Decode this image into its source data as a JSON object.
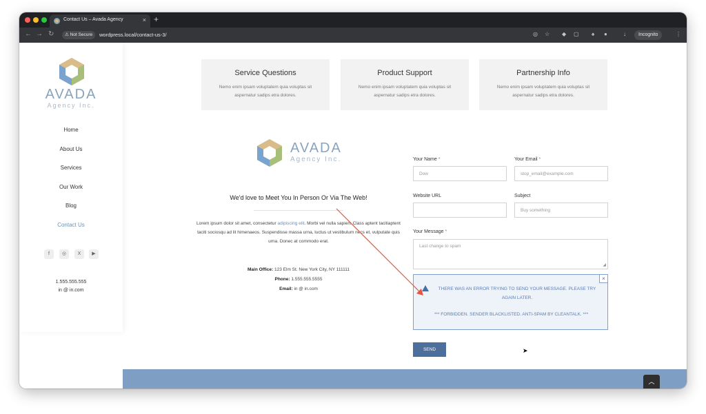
{
  "browser": {
    "tab_title": "Contact Us – Avada Agency",
    "tab_close": "×",
    "new_tab": "+",
    "not_secure": "⚠ Not Secure",
    "url": "wordpress.local/contact-us-3/",
    "incognito": "Incognito"
  },
  "sidebar": {
    "brand_name": "AVADA",
    "brand_sub": "Agency Inc.",
    "nav": [
      "Home",
      "About Us",
      "Services",
      "Our Work",
      "Blog",
      "Contact Us"
    ],
    "active_index": 5,
    "social": [
      "f",
      "◎",
      "X",
      "▶"
    ],
    "phone": "1.555.555.555",
    "email": "in @ in.com"
  },
  "cards": [
    {
      "title": "Service Questions",
      "text": "Nemo enim ipsam voluptatem quia voluptas sit aspernatur sadips etra dolores."
    },
    {
      "title": "Product Support",
      "text": "Nemo enim ipsam voluptatem quia voluptas sit aspernatur sadips etra dolores."
    },
    {
      "title": "Partnership Info",
      "text": "Nemo enim ipsam voluptatem quia voluptas sit aspernatur sadips etra dolores."
    }
  ],
  "content": {
    "brand_name": "AVADA",
    "brand_sub": "Agency Inc.",
    "tagline": "We'd love to Meet You In Person  Or Via The Web!",
    "lorem_a": "Lorem ipsum dolor sit amet, consectetur ",
    "lorem_link": "adipiscing elit",
    "lorem_b": ". Morbi vel nulla sapien. Class aptent taciti­aptent taciti sociosqu ad lit himenaeos. Suspendisse massa urna, luctus ut vestibulum necs et, vulputate quis urna. Donec at commodo erat.",
    "office_label": "Main Office:",
    "office_value": " 123 Elm St. New York City, NY 111111",
    "phone_label": "Phone:",
    "phone_value": " 1.555.555.5555",
    "email_label": "Email:",
    "email_value": " in @ in.com"
  },
  "form": {
    "name_label": "Your Name",
    "name_value": "Dow",
    "email_label": "Your Email",
    "email_value": "stop_email@example.com",
    "url_label": "Website URL",
    "url_value": "",
    "subject_label": "Subject",
    "subject_value": "Buy something",
    "message_label": "Your Message",
    "message_value": "Last change to spam",
    "required_mark": "*",
    "error_main": "There was an error trying to send your message. Please try again later.",
    "error_detail": "*** FORBIDDEN. SENDER BLACKLISTED. ANTI-SPAM BY CLEANTALK. ***",
    "alert_close": "×",
    "send_label": "SEND"
  },
  "colors": {
    "accent": "#6b8fb8",
    "alert_border": "#7f9fcc",
    "annotation_arrow": "#e8553a"
  }
}
